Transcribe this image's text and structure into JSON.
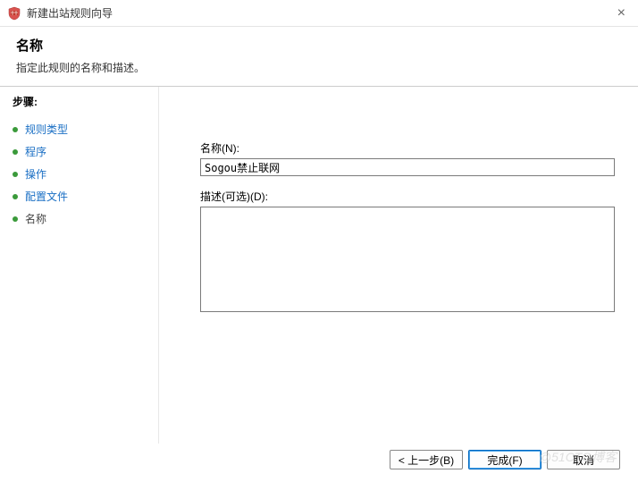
{
  "window": {
    "title": "新建出站规则向导"
  },
  "header": {
    "heading": "名称",
    "subtitle": "指定此规则的名称和描述。"
  },
  "sidebar": {
    "steps_label": "步骤:",
    "items": [
      {
        "label": "规则类型"
      },
      {
        "label": "程序"
      },
      {
        "label": "操作"
      },
      {
        "label": "配置文件"
      },
      {
        "label": "名称"
      }
    ]
  },
  "form": {
    "name_label": "名称(N):",
    "name_value": "Sogou禁止联网",
    "desc_label": "描述(可选)(D):",
    "desc_value": ""
  },
  "buttons": {
    "back": "< 上一步(B)",
    "finish": "完成(F)",
    "cancel": "取消"
  },
  "watermark": "@51CTO博客"
}
